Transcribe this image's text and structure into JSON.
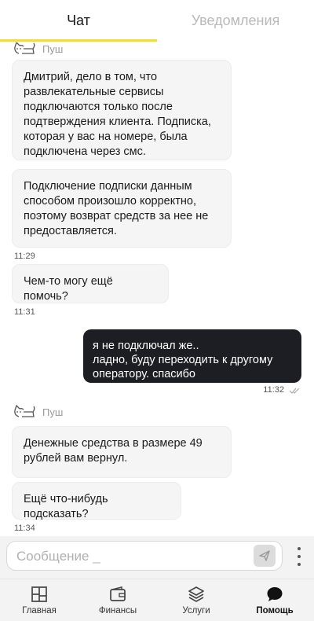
{
  "tabs": {
    "chat": "Чат",
    "notifications": "Уведомления"
  },
  "messages": {
    "sender1": "Пуш",
    "m1": "Дмитрий, дело в том, что развлекательные сервисы подключаются только после подтверждения клиента. Подписка, которая у вас на номере, была подключена через смс.",
    "m2": "Подключение подписки данным способом произошло корректно, поэтому возврат средств за нее не предоставляется.",
    "t1": "11:29",
    "m3": "Чем-то могу ещё помочь?",
    "t2": "11:31",
    "out1": "я не подключал же..\nладно, буду переходить к другому оператору. спасибо",
    "tout": "11:32",
    "sender2": "Пуш",
    "m4": "Денежные средства в размере 49 рублей вам вернул.",
    "m5": "Ещё что-нибудь подсказать?",
    "t3": "11:34"
  },
  "input": {
    "placeholder": "Сообщение _"
  },
  "nav": {
    "home": "Главная",
    "finance": "Финансы",
    "services": "Услуги",
    "help": "Помощь"
  },
  "icons": {
    "send": "send-icon",
    "more": "more-vertical-icon",
    "home": "grid-icon",
    "finance": "wallet-icon",
    "services": "layers-icon",
    "help": "speech-bubble-icon",
    "read": "double-check-icon",
    "cat": "cat-avatar-icon"
  },
  "colors": {
    "accent": "#f5dd2a",
    "outgoing_bubble": "#1d1e23",
    "incoming_bubble": "#f5f5f5"
  }
}
